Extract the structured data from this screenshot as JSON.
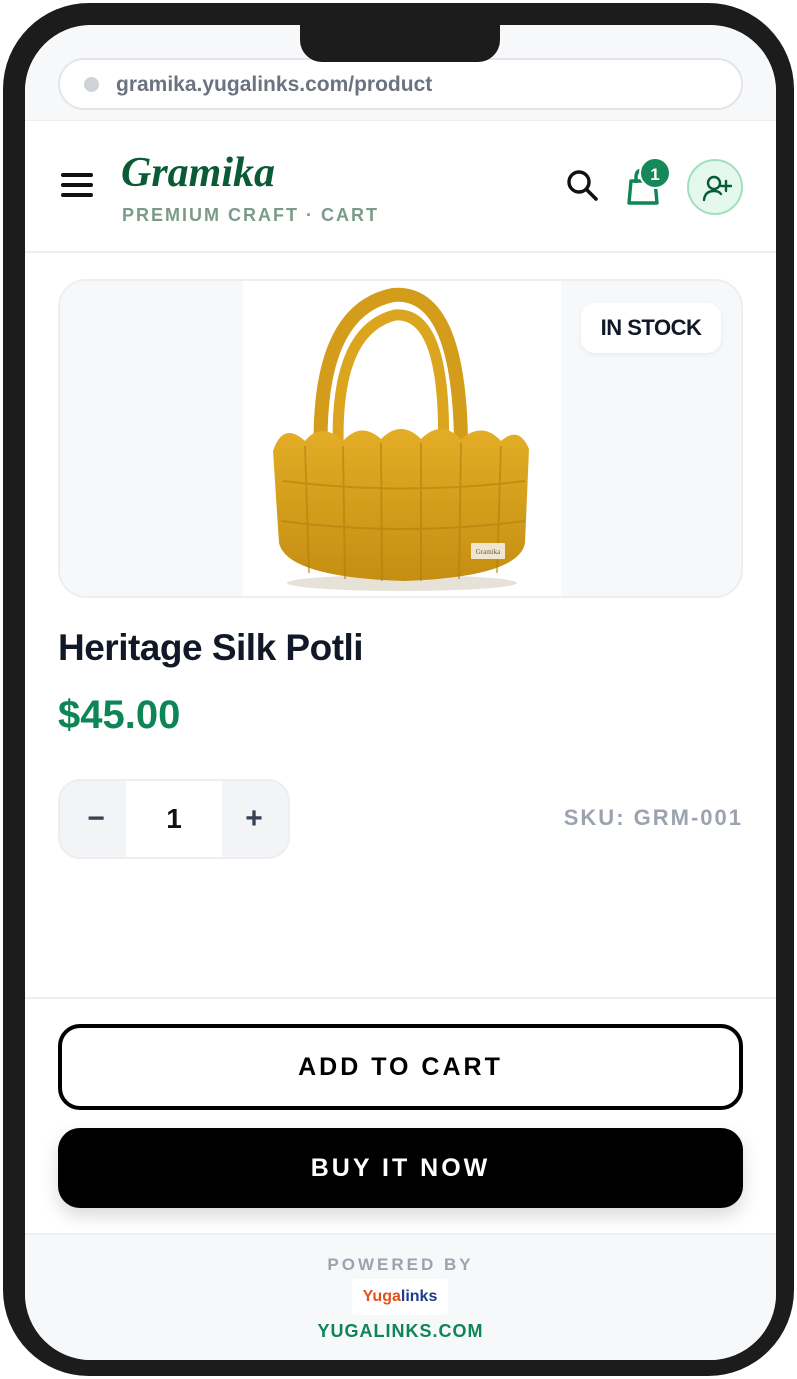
{
  "browser": {
    "url": "gramika.yugalinks.com/product"
  },
  "header": {
    "brand_name": "Gramika",
    "brand_tagline": "PREMIUM CRAFT · CART",
    "cart_count": "1",
    "icons": [
      "menu-icon",
      "search-icon",
      "shopping-bag-icon",
      "add-user-icon"
    ]
  },
  "product": {
    "stock_badge": "IN STOCK",
    "image_label": "Gramika",
    "title": "Heritage Silk Potli",
    "price": "$45.00",
    "quantity": "1",
    "qty_minus": "−",
    "qty_plus": "+",
    "sku": "SKU: GRM-001"
  },
  "actions": {
    "add_to_cart": "ADD TO CART",
    "buy_now": "BUY IT NOW"
  },
  "footer": {
    "powered_by": "POWERED BY",
    "logo_part1": "Yuga",
    "logo_part2": "links",
    "domain": "YUGALINKS.COM"
  },
  "colors": {
    "brand_green": "#0b5a36",
    "price_green": "#0e8556",
    "badge_green": "#16895a",
    "basket_yellow": "#d9a21c"
  }
}
